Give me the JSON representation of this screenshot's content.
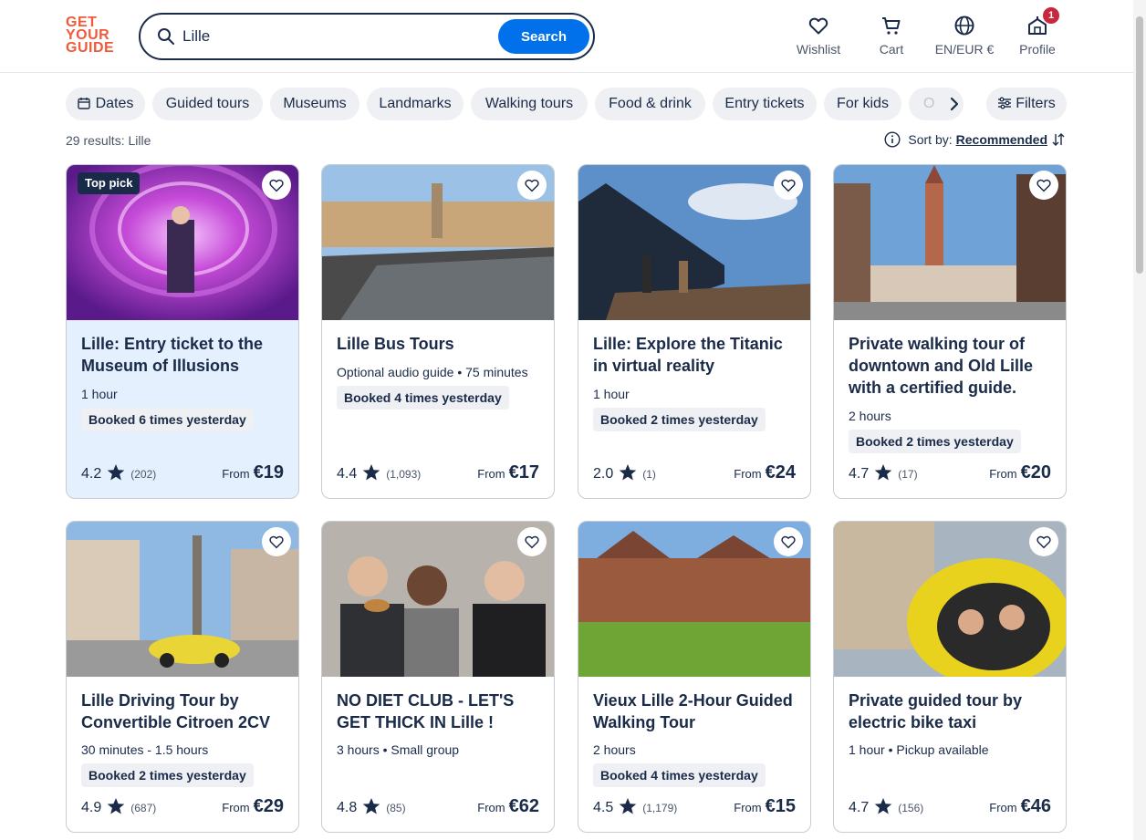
{
  "logo": {
    "line1": "GET",
    "line2": "YOUR",
    "line3": "GUIDE"
  },
  "search": {
    "value": "Lille",
    "button_label": "Search"
  },
  "header_nav": {
    "wishlist": "Wishlist",
    "cart": "Cart",
    "language": "EN/EUR €",
    "profile": "Profile",
    "profile_badge": "1"
  },
  "chips": [
    "Dates",
    "Guided tours",
    "Museums",
    "Landmarks",
    "Walking tours",
    "Food & drink",
    "Entry tickets",
    "For kids",
    "O"
  ],
  "filters_label": "Filters",
  "results_text": "29 results: Lille",
  "sort": {
    "label": "Sort by:",
    "value": "Recommended"
  },
  "cards": [
    {
      "title": "Lille: Entry ticket to the Museum of Illusions",
      "meta": "1 hour",
      "booked": "Booked 6 times yesterday",
      "rating": "4.2",
      "count": "(202)",
      "from": "From",
      "price": "€19",
      "badge": "Top pick"
    },
    {
      "title": "Lille Bus Tours",
      "meta": "Optional audio guide • 75 minutes",
      "booked": "Booked 4 times yesterday",
      "rating": "4.4",
      "count": "(1,093)",
      "from": "From",
      "price": "€17"
    },
    {
      "title": "Lille: Explore the Titanic in virtual reality",
      "meta": "1 hour",
      "booked": "Booked 2 times yesterday",
      "rating": "2.0",
      "count": "(1)",
      "from": "From",
      "price": "€24"
    },
    {
      "title": "Private walking tour of downtown and Old Lille with a certified guide.",
      "meta": "2 hours",
      "booked": "Booked 2 times yesterday",
      "rating": "4.7",
      "count": "(17)",
      "from": "From",
      "price": "€20"
    },
    {
      "title": "Lille Driving Tour by Convertible Citroen 2CV",
      "meta": "30 minutes - 1.5 hours",
      "booked": "Booked 2 times yesterday",
      "rating": "4.9",
      "count": "(687)",
      "from": "From",
      "price": "€29"
    },
    {
      "title": "NO DIET CLUB - LET'S GET THICK IN Lille !",
      "meta": "3 hours • Small group",
      "booked": "",
      "rating": "4.8",
      "count": "(85)",
      "from": "From",
      "price": "€62"
    },
    {
      "title": "Vieux Lille 2-Hour Guided Walking Tour",
      "meta": "2 hours",
      "booked": "Booked 4 times yesterday",
      "rating": "4.5",
      "count": "(1,179)",
      "from": "From",
      "price": "€15"
    },
    {
      "title": "Private guided tour by electric bike taxi",
      "meta": "1 hour • Pickup available",
      "booked": "",
      "rating": "4.7",
      "count": "(156)",
      "from": "From",
      "price": "€46"
    }
  ]
}
